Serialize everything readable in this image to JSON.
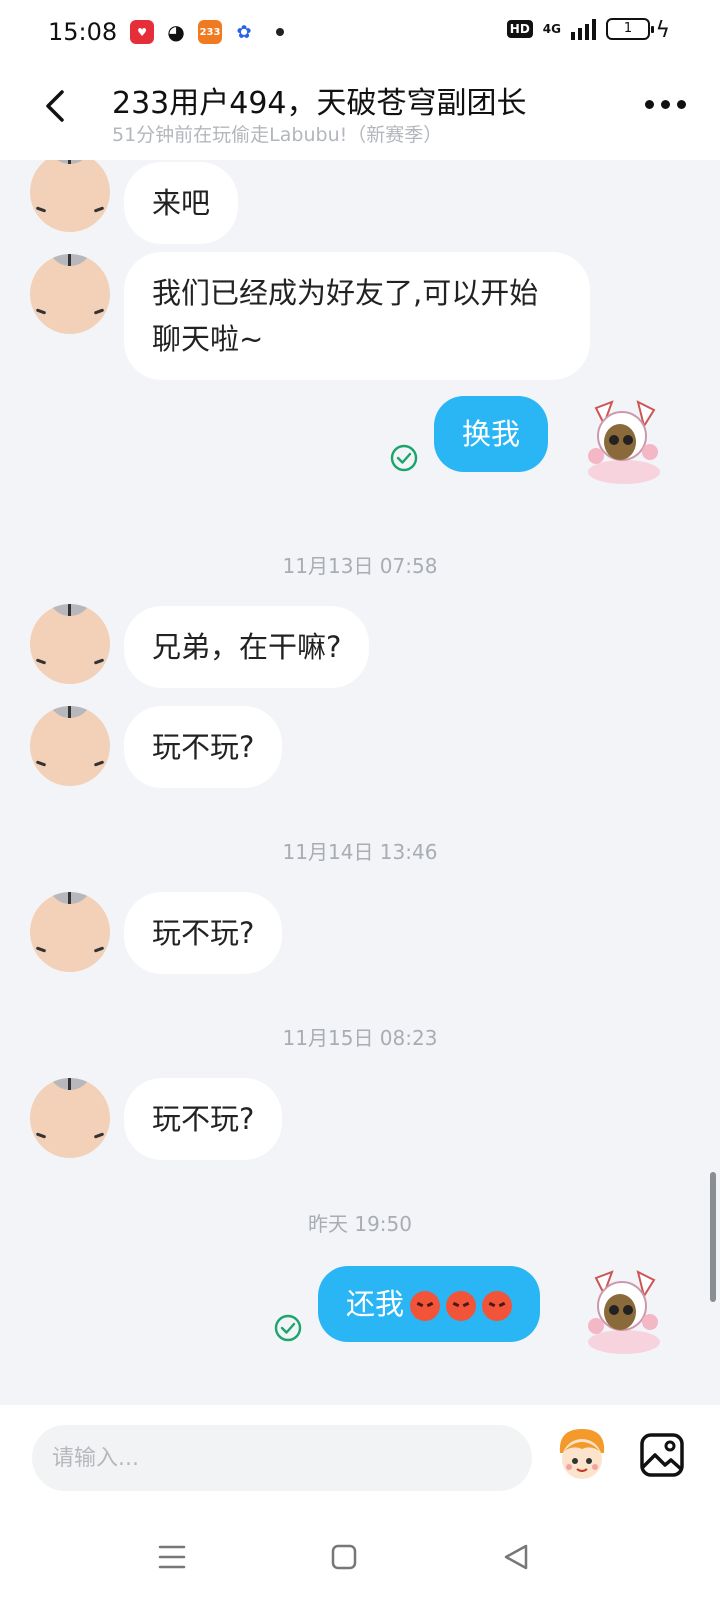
{
  "status_bar": {
    "time": "15:08",
    "app_icons": [
      "xiaohongshu-icon",
      "wechat-icon",
      "233-icon",
      "baidu-icon"
    ],
    "app_233_label": "233",
    "hd_label": "HD",
    "network_label": "4G",
    "battery_level": "1"
  },
  "header": {
    "back_icon": "chevron-left-icon",
    "title": "233用户494，天破苍穹副团长",
    "subtitle": "51分钟前在玩偷走Labubu!（新赛季）",
    "more_icon": "more-dots-icon"
  },
  "messages": [
    {
      "type": "incoming",
      "text": "来吧"
    },
    {
      "type": "incoming",
      "text": "我们已经成为好友了,可以开始聊天啦~"
    },
    {
      "type": "outgoing",
      "text": "换我",
      "status": "read"
    },
    {
      "type": "timestamp",
      "text": "11月13日 07:58"
    },
    {
      "type": "incoming",
      "text": "兄弟，在干嘛?"
    },
    {
      "type": "incoming",
      "text": "玩不玩?"
    },
    {
      "type": "timestamp",
      "text": "11月14日 13:46"
    },
    {
      "type": "incoming",
      "text": "玩不玩?"
    },
    {
      "type": "timestamp",
      "text": "11月15日 08:23"
    },
    {
      "type": "incoming",
      "text": "玩不玩?"
    },
    {
      "type": "timestamp",
      "text": "昨天 19:50"
    },
    {
      "type": "outgoing",
      "text": "还我",
      "emojis": [
        "angry-face-icon",
        "angry-face-icon",
        "angry-face-icon"
      ],
      "status": "read"
    }
  ],
  "input": {
    "placeholder": "请输入...",
    "value": "",
    "sticker_icon": "sticker-face-icon",
    "image_icon": "image-icon"
  },
  "nav": {
    "menu_icon": "menu-lines-icon",
    "home_icon": "home-square-icon",
    "back_icon": "back-triangle-icon"
  },
  "colors": {
    "outgoing_bubble": "#2ab5f5",
    "incoming_bubble": "#ffffff",
    "chat_background": "#f2f4f7",
    "read_check": "#1aa56a"
  }
}
